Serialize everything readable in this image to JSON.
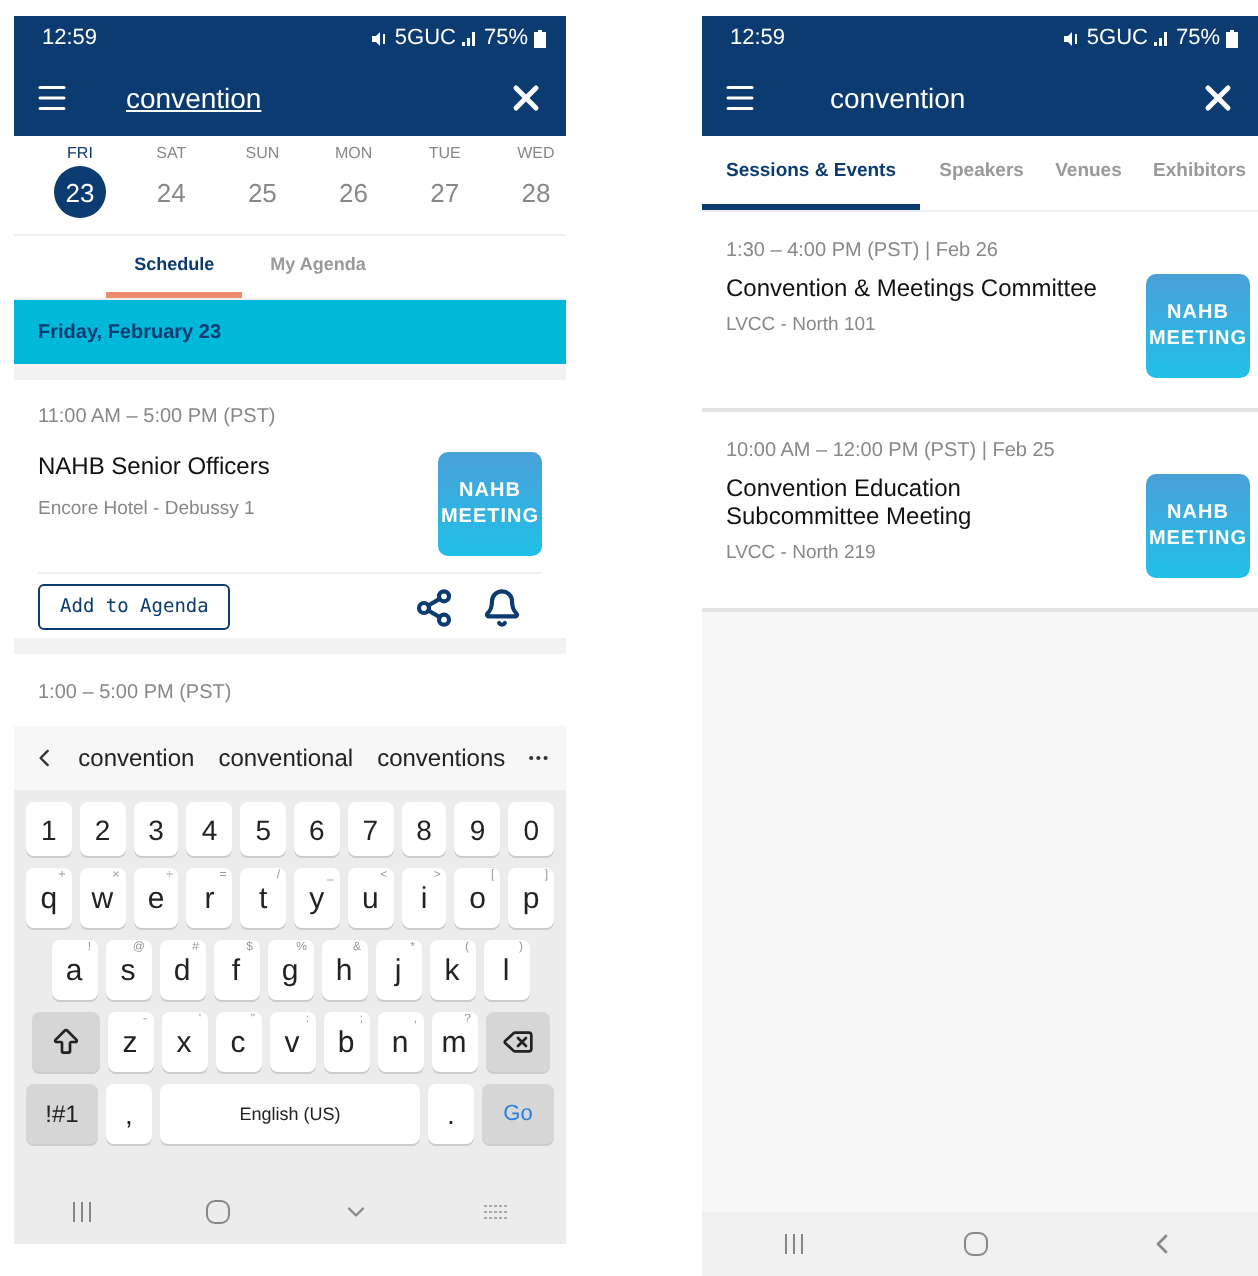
{
  "schedule_screen": {
    "status_bar": {
      "time": "12:59",
      "network": "5GUC",
      "battery": "75%"
    },
    "header": {
      "query": "convention"
    },
    "days": [
      {
        "weekday": "FRI",
        "date": "23",
        "selected": true
      },
      {
        "weekday": "SAT",
        "date": "24",
        "selected": false
      },
      {
        "weekday": "SUN",
        "date": "25",
        "selected": false
      },
      {
        "weekday": "MON",
        "date": "26",
        "selected": false
      },
      {
        "weekday": "TUE",
        "date": "27",
        "selected": false
      },
      {
        "weekday": "WED",
        "date": "28",
        "selected": false
      }
    ],
    "tabs": [
      {
        "label": "Schedule",
        "selected": true
      },
      {
        "label": "My Agenda",
        "selected": false
      }
    ],
    "date_band": "Friday, February 23",
    "events": [
      {
        "time": "11:00 AM – 5:00 PM (PST)",
        "title": "NAHB Senior Officers",
        "venue": "Encore Hotel - Debussy 1",
        "badge": "NAHB MEETING",
        "action": "Add to Agenda"
      },
      {
        "time": "1:00 – 5:00 PM (PST)"
      }
    ],
    "keyboard": {
      "suggestions": [
        "convention",
        "conventional",
        "conventions"
      ],
      "number_row": [
        "1",
        "2",
        "3",
        "4",
        "5",
        "6",
        "7",
        "8",
        "9",
        "0"
      ],
      "letter_rows": [
        [
          {
            "label": "q",
            "hint": "+"
          },
          {
            "label": "w",
            "hint": "×"
          },
          {
            "label": "e",
            "hint": "÷"
          },
          {
            "label": "r",
            "hint": "="
          },
          {
            "label": "t",
            "hint": "/"
          },
          {
            "label": "y",
            "hint": "_"
          },
          {
            "label": "u",
            "hint": "<"
          },
          {
            "label": "i",
            "hint": ">"
          },
          {
            "label": "o",
            "hint": "["
          },
          {
            "label": "p",
            "hint": "]"
          }
        ],
        [
          {
            "label": "a",
            "hint": "!"
          },
          {
            "label": "s",
            "hint": "@"
          },
          {
            "label": "d",
            "hint": "#"
          },
          {
            "label": "f",
            "hint": "$"
          },
          {
            "label": "g",
            "hint": "%"
          },
          {
            "label": "h",
            "hint": "&"
          },
          {
            "label": "j",
            "hint": "*"
          },
          {
            "label": "k",
            "hint": "("
          },
          {
            "label": "l",
            "hint": ")"
          }
        ],
        [
          {
            "label": "z",
            "hint": "-"
          },
          {
            "label": "x",
            "hint": "'"
          },
          {
            "label": "c",
            "hint": "\""
          },
          {
            "label": "v",
            "hint": ":"
          },
          {
            "label": "b",
            "hint": ";"
          },
          {
            "label": "n",
            "hint": ","
          },
          {
            "label": "m",
            "hint": "?"
          }
        ]
      ],
      "bottom_row": [
        {
          "label": "!#1",
          "kind": "mod"
        },
        {
          "label": ",",
          "kind": "char"
        },
        {
          "label": "English (US)",
          "kind": "space"
        },
        {
          "label": ".",
          "kind": "char"
        },
        {
          "label": "Go",
          "kind": "action"
        }
      ]
    }
  },
  "search_screen": {
    "status_bar": {
      "time": "12:59",
      "network": "5GUC",
      "battery": "75%"
    },
    "header": {
      "query": "convention"
    },
    "tabs": [
      {
        "label": "Sessions & Events",
        "selected": true
      },
      {
        "label": "Speakers",
        "selected": false
      },
      {
        "label": "Venues",
        "selected": false
      },
      {
        "label": "Exhibitors",
        "selected": false
      }
    ],
    "results": [
      {
        "time": "1:30 – 4:00 PM (PST) | Feb 26",
        "title": "Convention & Meetings Committee",
        "venue": "LVCC - North 101",
        "badge": "NAHB MEETING"
      },
      {
        "time": "10:00 AM – 12:00 PM (PST) | Feb 25",
        "title": "Convention Education Subcommittee Meeting",
        "venue": "LVCC - North 219",
        "badge": "NAHB MEETING"
      }
    ]
  }
}
